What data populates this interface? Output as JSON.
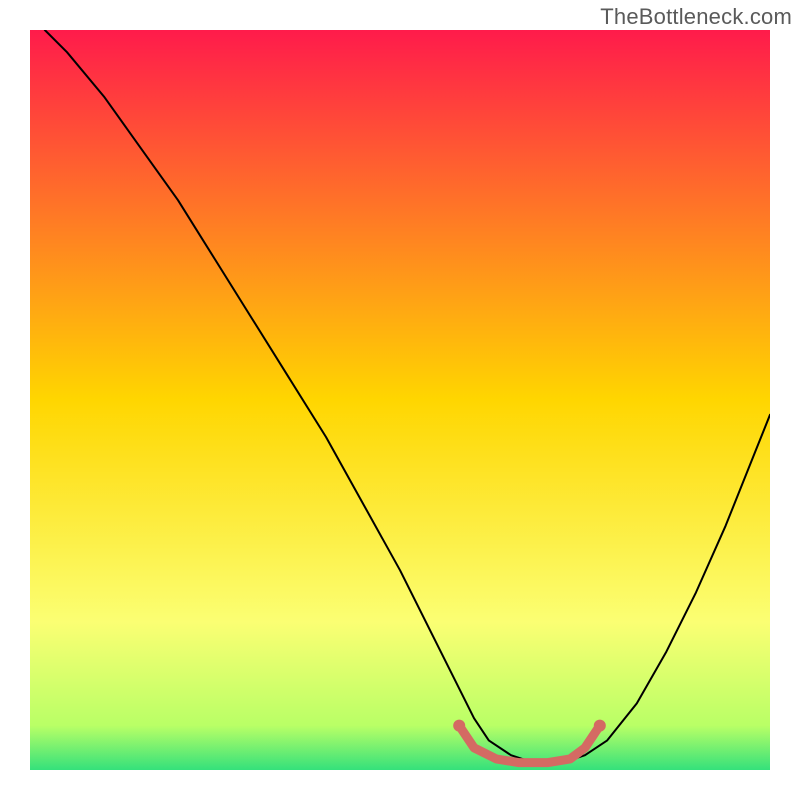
{
  "watermark": "TheBottleneck.com",
  "chart_data": {
    "type": "line",
    "title": "",
    "xlabel": "",
    "ylabel": "",
    "xlim": [
      0,
      100
    ],
    "ylim": [
      0,
      100
    ],
    "background_gradient": [
      {
        "stop": 0.0,
        "color": "#ff1b4b"
      },
      {
        "stop": 0.5,
        "color": "#ffd600"
      },
      {
        "stop": 0.8,
        "color": "#fbff73"
      },
      {
        "stop": 0.94,
        "color": "#b9ff66"
      },
      {
        "stop": 1.0,
        "color": "#34e17b"
      }
    ],
    "series": [
      {
        "name": "bottleneck-curve",
        "color": "#000000",
        "width": 2,
        "x": [
          2,
          5,
          10,
          15,
          20,
          25,
          30,
          35,
          40,
          45,
          50,
          55,
          58,
          60,
          62,
          65,
          68,
          72,
          75,
          78,
          82,
          86,
          90,
          94,
          98,
          100
        ],
        "y": [
          100,
          97,
          91,
          84,
          77,
          69,
          61,
          53,
          45,
          36,
          27,
          17,
          11,
          7,
          4,
          2,
          1,
          1,
          2,
          4,
          9,
          16,
          24,
          33,
          43,
          48
        ]
      },
      {
        "name": "optimal-zone-marker",
        "color": "#d46a63",
        "width": 9,
        "x": [
          58,
          60,
          63,
          66,
          70,
          73,
          75,
          77
        ],
        "y": [
          6,
          3,
          1.5,
          1,
          1,
          1.5,
          3,
          6
        ]
      }
    ],
    "marker_dots": [
      {
        "x": 58,
        "y": 6,
        "r": 6,
        "color": "#d46a63"
      },
      {
        "x": 77,
        "y": 6,
        "r": 6,
        "color": "#d46a63"
      }
    ]
  }
}
